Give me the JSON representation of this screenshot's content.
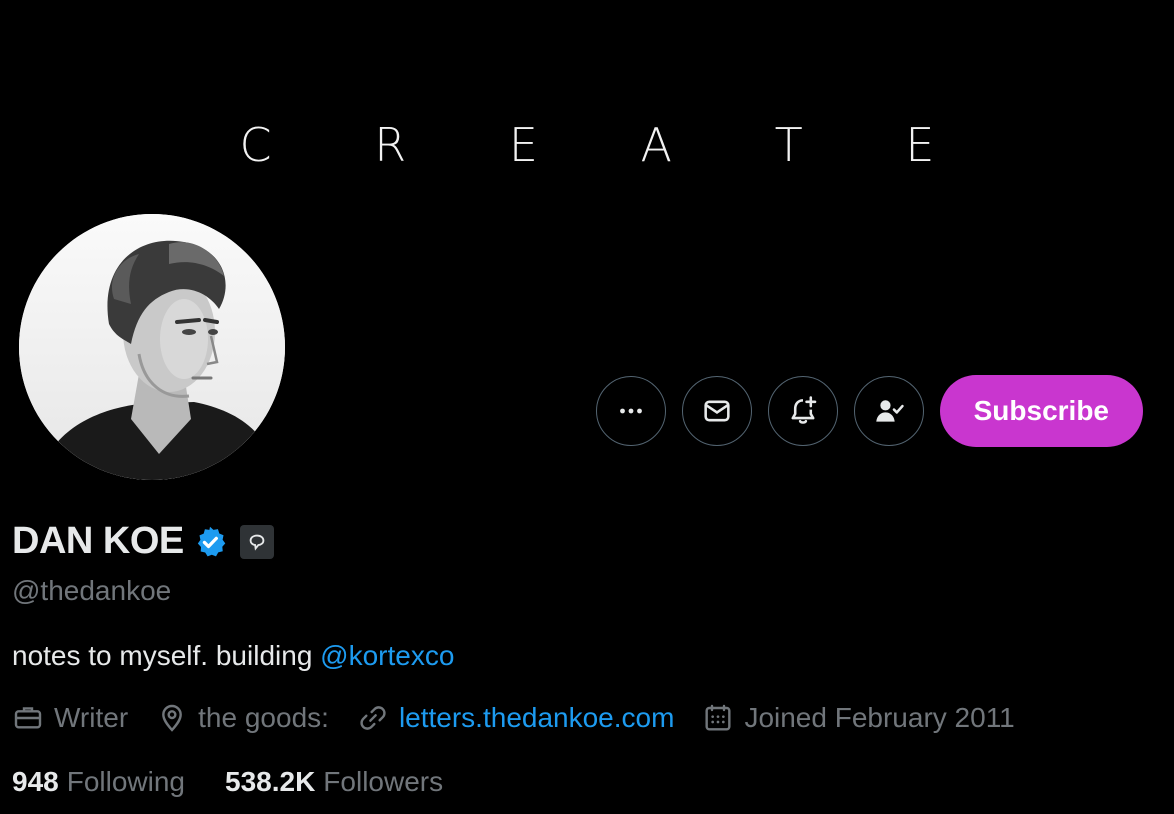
{
  "banner": {
    "text": "C R E A T E"
  },
  "actions": {
    "more_icon": "more-dots-icon",
    "message_icon": "envelope-icon",
    "notify_icon": "bell-plus-icon",
    "following_icon": "person-check-icon",
    "subscribe_label": "Subscribe",
    "subscribe_color": "#c936cf"
  },
  "profile": {
    "name": "DAN KOE",
    "handle": "@thedankoe",
    "bio_text": "notes to myself. building ",
    "bio_mention": "@kortexco",
    "verified_color": "#1d9bf0"
  },
  "meta": {
    "profession": "Writer",
    "location": "the goods:",
    "website": "letters.thedankoe.com",
    "joined": "Joined February 2011"
  },
  "stats": {
    "following_count": "948",
    "following_label": "Following",
    "followers_count": "538.2K",
    "followers_label": "Followers"
  }
}
